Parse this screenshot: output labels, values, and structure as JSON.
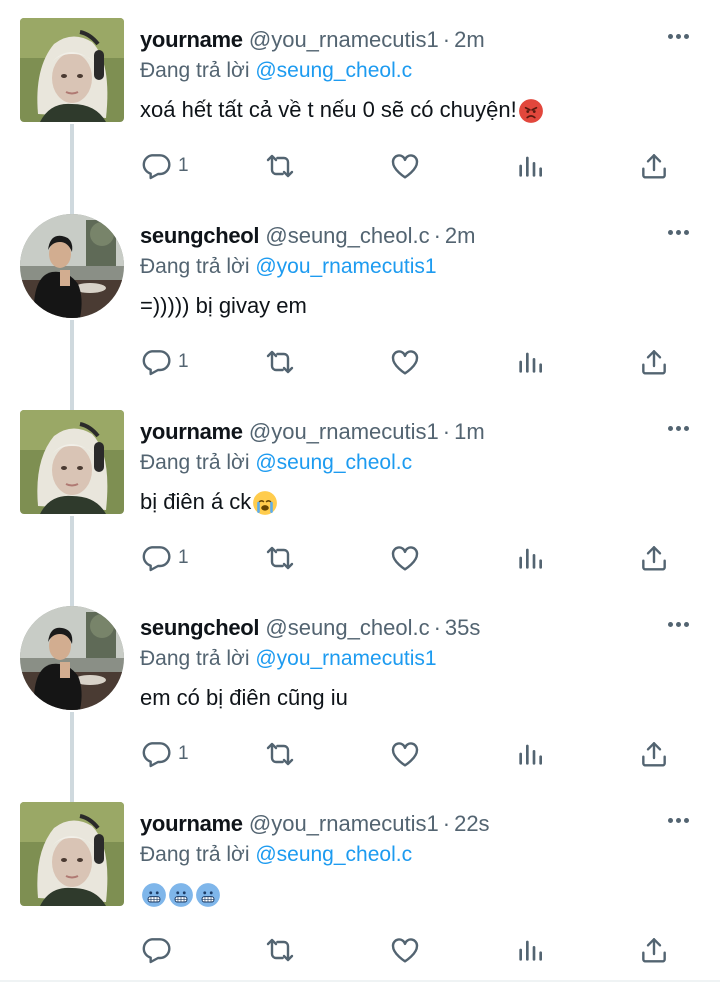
{
  "colors": {
    "accent": "#1d9bf0",
    "secondary_text": "#536471",
    "primary_text": "#0f1419",
    "thread_line": "#cfd9de"
  },
  "replying_prefix": "Đang trả lời",
  "tweets": [
    {
      "name": "yourname",
      "handle": "@you_rnamecutis1",
      "sep": "·",
      "time": "2m",
      "reply_to": "@seung_cheol.c",
      "text": "xoá hết tất cả về t nếu 0 sẽ có chuyện!",
      "emojis": [
        "angry-face"
      ],
      "reply_count": "1",
      "avatar": "blonde-girl-headphones-avatar"
    },
    {
      "name": "seungcheol",
      "handle": "@seung_cheol.c",
      "sep": "·",
      "time": "2m",
      "reply_to": "@you_rnamecutis1",
      "text": "=))))) bị givay em",
      "emojis": [],
      "reply_count": "1",
      "avatar": "man-in-restaurant-avatar"
    },
    {
      "name": "yourname",
      "handle": "@you_rnamecutis1",
      "sep": "·",
      "time": "1m",
      "reply_to": "@seung_cheol.c",
      "text": "bị điên á ck",
      "emojis": [
        "loudly-crying-face"
      ],
      "reply_count": "1",
      "avatar": "blonde-girl-headphones-avatar"
    },
    {
      "name": "seungcheol",
      "handle": "@seung_cheol.c",
      "sep": "·",
      "time": "35s",
      "reply_to": "@you_rnamecutis1",
      "text": "em có bị điên cũng iu",
      "emojis": [],
      "reply_count": "1",
      "avatar": "man-in-restaurant-avatar"
    },
    {
      "name": "yourname",
      "handle": "@you_rnamecutis1",
      "sep": "·",
      "time": "22s",
      "reply_to": "@seung_cheol.c",
      "text": "",
      "emojis": [
        "cold-face",
        "cold-face",
        "cold-face"
      ],
      "reply_count": "",
      "avatar": "blonde-girl-headphones-avatar"
    }
  ],
  "icons": [
    "reply-icon",
    "retweet-icon",
    "like-icon",
    "views-icon",
    "share-icon",
    "more-icon"
  ]
}
